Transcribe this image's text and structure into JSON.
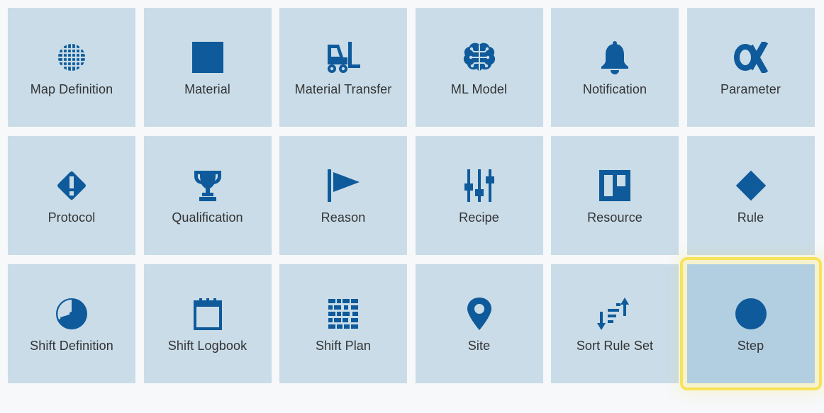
{
  "colors": {
    "tile_bg": "#c9dce8",
    "tile_selected_bg": "#b2cfe2",
    "icon": "#0e5a9a",
    "highlight": "#f8e257"
  },
  "tiles": [
    {
      "label": "Map Definition",
      "icon": "grid-globe-icon"
    },
    {
      "label": "Material",
      "icon": "square-icon"
    },
    {
      "label": "Material Transfer",
      "icon": "forklift-icon"
    },
    {
      "label": "ML Model",
      "icon": "brain-icon"
    },
    {
      "label": "Notification",
      "icon": "bell-icon"
    },
    {
      "label": "Parameter",
      "icon": "alpha-icon"
    },
    {
      "label": "Protocol",
      "icon": "diamond-exclamation-icon"
    },
    {
      "label": "Qualification",
      "icon": "trophy-icon"
    },
    {
      "label": "Reason",
      "icon": "flag-icon"
    },
    {
      "label": "Recipe",
      "icon": "sliders-icon"
    },
    {
      "label": "Resource",
      "icon": "board-icon"
    },
    {
      "label": "Rule",
      "icon": "diamond-icon"
    },
    {
      "label": "Shift Definition",
      "icon": "clock-pie-icon"
    },
    {
      "label": "Shift Logbook",
      "icon": "calendar-icon"
    },
    {
      "label": "Shift Plan",
      "icon": "schedule-grid-icon"
    },
    {
      "label": "Site",
      "icon": "map-pin-icon"
    },
    {
      "label": "Sort Rule Set",
      "icon": "sort-icon"
    },
    {
      "label": "Step",
      "icon": "circle-icon",
      "selected": true
    }
  ]
}
